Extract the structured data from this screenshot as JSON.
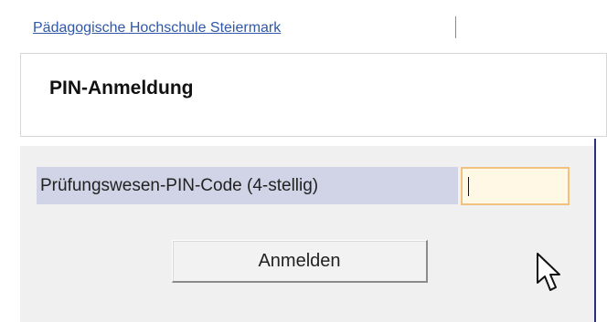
{
  "header": {
    "link_text": "Pädagogische Hochschule Steiermark",
    "title": "PIN-Anmeldung"
  },
  "form": {
    "pin_label": "Prüfungswesen-PIN-Code (4-stellig)",
    "pin_value": "",
    "submit_label": "Anmelden"
  },
  "icons": {
    "cursor": "mouse-pointer-icon"
  },
  "colors": {
    "link": "#2f58a8",
    "label_band": "#d1d3e6",
    "input_border": "#efc27f",
    "input_bg": "#fff8e4",
    "panel_border": "#2d2d82"
  }
}
